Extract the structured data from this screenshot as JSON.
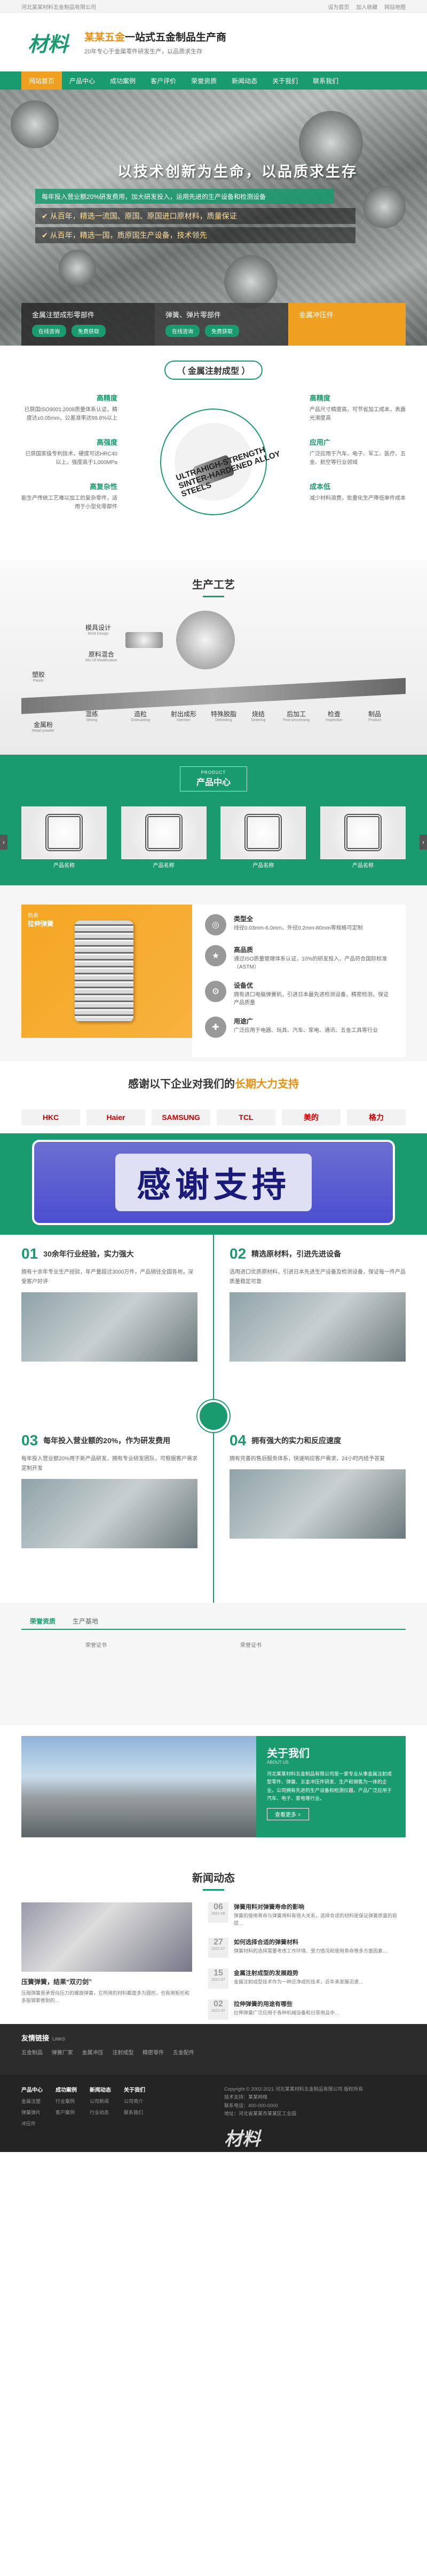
{
  "topbar": {
    "left": "河北某某材料五金制品有限公司",
    "links": [
      "设为首页",
      "加入收藏",
      "网站地图"
    ]
  },
  "brand": {
    "logo": "材料",
    "slogan_highlight": "某某五金",
    "slogan_rest": "一站式五金制品生产商",
    "sub": "20年专心于金属零件研发生产，以品质求生存"
  },
  "nav": [
    "网站首页",
    "产品中心",
    "成功案例",
    "客户评价",
    "荣誉资质",
    "新闻动态",
    "关于我们",
    "联系我们"
  ],
  "banner": {
    "headline": "以技术创新为生命，以品质求生存",
    "line1": "每年投入营业额20%研发费用，加大研发投入，运用先进的生产设备和检测设备",
    "line2": "✔ 从百年，精选一流国、原国、原国进口原材料，质量保证",
    "line3": "✔ 从百年，精选一国，质原国生产设备，技术领先"
  },
  "quick": [
    {
      "title": "金属注塑成形零部件",
      "btns": [
        "在线咨询",
        "免费获取"
      ]
    },
    {
      "title": "弹簧、弹片零部件",
      "btns": [
        "在线咨询",
        "免费获取"
      ]
    },
    {
      "title": "金属冲压件",
      "btns": []
    }
  ],
  "mim": {
    "title": "（ 金属注射成型 ）",
    "left": [
      {
        "h": "高精度",
        "p": "已获国ISO9001:2008质量体系认证，精度达±0.05mm，公差准率达99.8%以上"
      },
      {
        "h": "高强度",
        "p": "已获国家级专利技术，硬度可达HRC40以上，强度高于1,000MPa"
      },
      {
        "h": "高复杂性",
        "p": "能生产传统工艺难以加工的复杂零件，适用于小型化零部件"
      }
    ],
    "right": [
      {
        "h": "高精度",
        "p": "产品尺寸精度高，可节省加工成本，表面光滑度高"
      },
      {
        "h": "应用广",
        "p": "广泛应用于汽车、电子、军工、医疗、五金、航空等行业领域"
      },
      {
        "h": "成本低",
        "p": "减少材料浪费，批量化生产降低单件成本"
      }
    ],
    "center_text": "ULTRAHIGH-STRENGTH SINTER-HARDENED ALLOY STEELS"
  },
  "process": {
    "title": "生产工艺",
    "top": [
      {
        "cn": "模具设计",
        "en": "Mold Design"
      },
      {
        "cn": "原料混合",
        "en": "Mix Of Modification"
      }
    ],
    "left": [
      {
        "cn": "塑胶",
        "en": "Plastic"
      },
      {
        "cn": "金属粉",
        "en": "Metal powder"
      }
    ],
    "steps": [
      {
        "cn": "混练",
        "en": "Mixing"
      },
      {
        "cn": "造粒",
        "en": "Granulating"
      },
      {
        "cn": "射出成形",
        "en": "Injection"
      },
      {
        "cn": "特殊脱脂",
        "en": "Debinding"
      },
      {
        "cn": "烧结",
        "en": "Sintering"
      },
      {
        "cn": "后加工",
        "en": "Post-processing"
      },
      {
        "cn": "检查",
        "en": "Inspection"
      },
      {
        "cn": "制品",
        "en": "Product"
      }
    ]
  },
  "products": {
    "title": "产品中心",
    "en": "PRODUCT",
    "items": [
      "产品名称",
      "产品名称",
      "产品名称",
      "产品名称"
    ]
  },
  "feature": {
    "tag": "热卖",
    "name": "拉伸弹簧",
    "specs": [
      {
        "h": "类型全",
        "p": "线径0.03mm-6.0mm，外径0.2mm-80mm等规格可定制"
      },
      {
        "h": "高品质",
        "p": "通过ISO质量管理体系认证，10%的研发投入，产品符合国际标准（ASTM）"
      },
      {
        "h": "设备优",
        "p": "拥有进口电脑弹簧机，引进日本最先进检测设备，精密检测，保证产品质量"
      },
      {
        "h": "用途广",
        "p": "广泛应用于电器、玩具、汽车、家电、通讯、五金工具等行业"
      }
    ]
  },
  "clients": {
    "title_a": "感谢以下企业对我们的",
    "title_b": "长期大力支持",
    "logos": [
      "HKC",
      "Haier",
      "SAMSUNG",
      "TCL",
      "美的",
      "格力"
    ]
  },
  "thanks": {
    "text": "感谢支持"
  },
  "advantages": [
    {
      "num": "01",
      "title": "30余年行业经验，实力强大",
      "p": "拥有十余年专业生产经验，年产量超过3000万件，产品销往全国各地，深受客户好评"
    },
    {
      "num": "02",
      "title": "精选原材料，引进先进设备",
      "p": "选用进口优质原材料，引进日本先进生产设备及检测设备，保证每一件产品质量稳定可靠"
    },
    {
      "num": "03",
      "title": "每年投入营业额的20%，作为研发费用",
      "p": "每年投入营业额20%用于新产品研发，拥有专业研发团队，可根据客户需求定制开发"
    },
    {
      "num": "04",
      "title": "拥有强大的实力和反应速度",
      "p": "拥有完善的售后服务体系，快速响应客户需求，24小时内给予答复"
    }
  ],
  "cases": {
    "tabs": [
      "荣誉资质",
      "生产基地"
    ],
    "items": [
      "荣誉证书",
      "荣誉证书"
    ]
  },
  "about": {
    "title": "关于我们",
    "en": "ABOUT US",
    "p": "河北某某材料五金制品有限公司是一家专业从事金属注射成型零件、弹簧、五金冲压件研发、生产和销售为一体的企业。公司拥有先进的生产设备和检测仪器，产品广泛应用于汽车、电子、家电等行业。",
    "more": "查看更多 >"
  },
  "news": {
    "title": "新闻动态",
    "feature_title": "压簧弹簧，结果“双刃剑”",
    "feature_p": "压缩弹簧是承受向压力的螺旋弹簧，它所用的材料截面多为圆形，也有用矩形和多股钢索卷制的…",
    "items": [
      {
        "day": "06",
        "month": "2021-08",
        "t": "弹簧用料对弹簧寿命的影响",
        "p": "弹簧的使用寿命与弹簧用料有很大关系，选择合适的材料是保证弹簧质量的前提…"
      },
      {
        "day": "27",
        "month": "2021-07",
        "t": "如何选择合适的弹簧材料",
        "p": "弹簧材料的选择需要考虑工作环境、受力情况和使用寿命等多方面因素…"
      },
      {
        "day": "15",
        "month": "2021-07",
        "t": "金属注射成型的发展趋势",
        "p": "金属注射成型技术作为一种近净成形技术，近年来发展迅速…"
      },
      {
        "day": "02",
        "month": "2021-07",
        "t": "拉伸弹簧的用途有哪些",
        "p": "拉伸弹簧广泛应用于各种机械设备和日常用品中…"
      }
    ]
  },
  "flinks": {
    "title": "友情链接",
    "en": "LINKS",
    "items": [
      "五金制品",
      "弹簧厂家",
      "金属冲压",
      "注射成型",
      "精密零件",
      "五金配件"
    ]
  },
  "footer": {
    "cols": [
      {
        "t": "产品中心",
        "items": [
          "金属注塑",
          "弹簧弹片",
          "冲压件"
        ]
      },
      {
        "t": "成功案例",
        "items": [
          "行业案例",
          "客户案例"
        ]
      },
      {
        "t": "新闻动态",
        "items": [
          "公司新闻",
          "行业动态"
        ]
      },
      {
        "t": "关于我们",
        "items": [
          "公司简介",
          "联系我们"
        ]
      }
    ],
    "info": [
      "Copyright © 2002-2021 河北某某材料五金制品有限公司 版权所有",
      "技术支持：某某网络",
      "联系电话：400-000-0000",
      "地址：河北省某某市某某区工业园"
    ],
    "logo": "材料"
  }
}
